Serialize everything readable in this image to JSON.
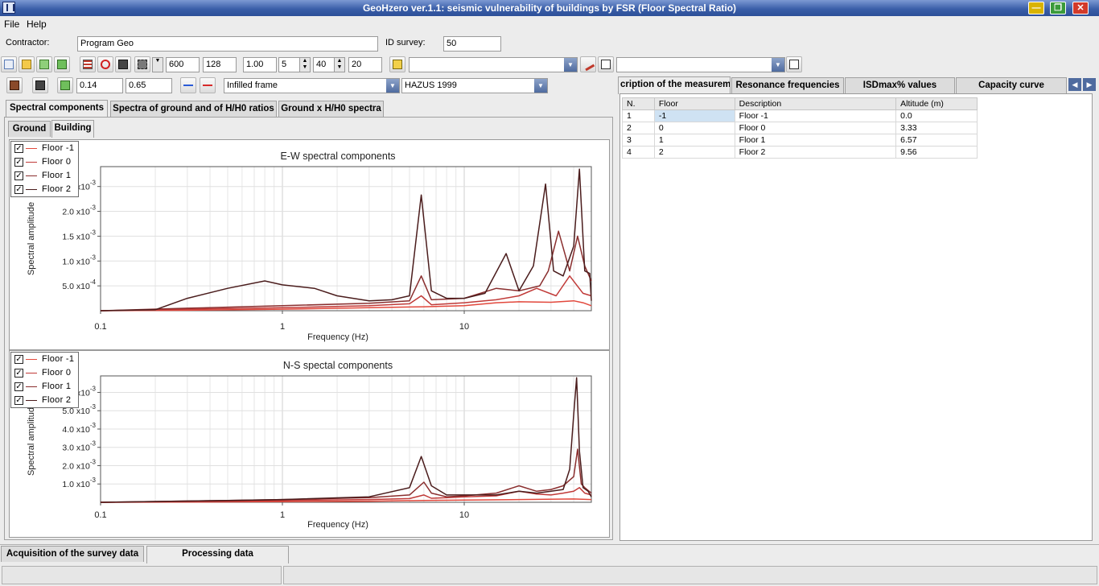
{
  "window": {
    "title": "GeoHzero ver.1.1: seismic vulnerability of buildings by FSR  (Floor Spectral Ratio)"
  },
  "menu": [
    "File",
    "Help"
  ],
  "form": {
    "contractor_label": "Contractor:",
    "contractor_value": "Program Geo",
    "survey_label": "ID survey:",
    "survey_value": "50"
  },
  "toolbar": {
    "values": [
      "600",
      "128",
      "1.00",
      "5",
      "40",
      "20"
    ],
    "selector1": "",
    "selector2": ""
  },
  "toolbar2": {
    "val1": "0.14",
    "val2": "0.65",
    "structure_type": "Infilled frame",
    "code": "HAZUS 1999"
  },
  "left_tabs": [
    "Spectral components",
    "Spectra of ground and of H/H0 ratios",
    "Ground x H/H0 spectra"
  ],
  "sub_tabs": [
    "Ground",
    "Building"
  ],
  "legend": [
    "Floor -1",
    "Floor 0",
    "Floor 1",
    "Floor 2"
  ],
  "colors": {
    "floor_m1": "#e2483c",
    "floor_0": "#c03a38",
    "floor_1": "#8a2e2e",
    "floor_2": "#4a1c1c"
  },
  "right_tabs": [
    "cription of the measurements",
    "Resonance frequencies",
    "ISDmax% values",
    "Capacity curve"
  ],
  "table": {
    "headers": [
      "N.",
      "Floor",
      "Description",
      "Altitude (m)"
    ],
    "rows": [
      [
        "1",
        "-1",
        "Floor -1",
        "0.0"
      ],
      [
        "2",
        "0",
        "Floor 0",
        "3.33"
      ],
      [
        "3",
        "1",
        "Floor 1",
        "6.57"
      ],
      [
        "4",
        "2",
        "Floor 2",
        "9.56"
      ]
    ]
  },
  "bottom_tabs": [
    "Acquisition of the survey data",
    "Processing data"
  ],
  "chart_data": [
    {
      "type": "line",
      "title": "E-W spectral components",
      "xlabel": "Frequency (Hz)",
      "ylabel": "Spectral amplitude",
      "xscale": "log",
      "xlim": [
        0.1,
        50
      ],
      "ylim": [
        0,
        0.0029
      ],
      "xticks": [
        "0.1",
        "1",
        "10"
      ],
      "yticks": [
        {
          "m": "5.0",
          "e": "-4",
          "v": 0.0005
        },
        {
          "m": "1.0",
          "e": "-3",
          "v": 0.001
        },
        {
          "m": "1.5",
          "e": "-3",
          "v": 0.0015
        },
        {
          "m": "2.0",
          "e": "-3",
          "v": 0.002
        },
        {
          "m": "",
          "e": "-3",
          "v": 0.0025
        }
      ],
      "legend_position": "top-left",
      "grid": true,
      "series": [
        {
          "name": "Floor -1",
          "x": [
            0.1,
            0.3,
            1,
            3,
            6,
            10,
            15,
            20,
            30,
            40,
            45,
            50
          ],
          "y": [
            0,
            1e-05,
            3e-05,
            6e-05,
            8e-05,
            0.0001,
            0.00016,
            0.00018,
            0.00017,
            0.0002,
            0.00016,
            0.0001
          ]
        },
        {
          "name": "Floor 0",
          "x": [
            0.1,
            0.3,
            1,
            3,
            5,
            5.8,
            6.6,
            10,
            15,
            20,
            25,
            32,
            38,
            45,
            50
          ],
          "y": [
            0,
            3e-05,
            6e-05,
            0.0001,
            0.00014,
            0.0003,
            0.00012,
            0.00016,
            0.00022,
            0.0003,
            0.00045,
            0.0003,
            0.0007,
            0.00035,
            0.0003
          ]
        },
        {
          "name": "Floor 1",
          "x": [
            0.1,
            0.3,
            1,
            3,
            5,
            5.8,
            6.6,
            10,
            15,
            20,
            26,
            29,
            33,
            38,
            42,
            46,
            50
          ],
          "y": [
            0,
            5e-05,
            0.0001,
            0.00015,
            0.0002,
            0.0007,
            0.00022,
            0.00025,
            0.00045,
            0.0004,
            0.0005,
            0.0008,
            0.0016,
            0.0008,
            0.0015,
            0.0009,
            0.0006
          ]
        },
        {
          "name": "Floor 2",
          "x": [
            0.1,
            0.2,
            0.3,
            0.5,
            0.8,
            1,
            1.5,
            2,
            3,
            4,
            5,
            5.8,
            6.6,
            8,
            10,
            13,
            17,
            20,
            24,
            28,
            31,
            35,
            40,
            43,
            46,
            49,
            50
          ],
          "y": [
            0,
            2e-05,
            0.00025,
            0.00045,
            0.0006,
            0.00052,
            0.00045,
            0.0003,
            0.0002,
            0.00022,
            0.0003,
            0.00233,
            0.0004,
            0.00025,
            0.00025,
            0.00035,
            0.00115,
            0.0004,
            0.0009,
            0.00255,
            0.0008,
            0.0007,
            0.0013,
            0.00285,
            0.0008,
            0.00075,
            0.0002
          ]
        }
      ]
    },
    {
      "type": "line",
      "title": "N-S spectal components",
      "xlabel": "Frequency (Hz)",
      "ylabel": "Spectral amplitude",
      "xscale": "log",
      "xlim": [
        0.1,
        50
      ],
      "ylim": [
        0,
        0.0069
      ],
      "xticks": [
        "0.1",
        "1",
        "10"
      ],
      "yticks": [
        {
          "m": "1.0",
          "e": "-3",
          "v": 0.001
        },
        {
          "m": "2.0",
          "e": "-3",
          "v": 0.002
        },
        {
          "m": "3.0",
          "e": "-3",
          "v": 0.003
        },
        {
          "m": "4.0",
          "e": "-3",
          "v": 0.004
        },
        {
          "m": "5.0",
          "e": "-3",
          "v": 0.005
        },
        {
          "m": "",
          "e": "-3",
          "v": 0.006
        }
      ],
      "legend_position": "top-left",
      "grid": true,
      "series": [
        {
          "name": "Floor -1",
          "x": [
            0.1,
            0.5,
            1,
            3,
            6,
            10,
            20,
            40,
            50
          ],
          "y": [
            0,
            2e-05,
            4e-05,
            6e-05,
            0.0001,
            0.00012,
            0.00015,
            0.00018,
            0.00015
          ]
        },
        {
          "name": "Floor 0",
          "x": [
            0.1,
            0.5,
            1,
            3,
            5,
            6,
            6.6,
            8,
            10,
            15,
            20,
            25,
            30,
            35,
            40,
            43,
            46,
            50
          ],
          "y": [
            0,
            5e-05,
            0.0001,
            0.00015,
            0.0002,
            0.0004,
            0.00022,
            0.00025,
            0.0003,
            0.00035,
            0.0006,
            0.00045,
            0.0004,
            0.0005,
            0.0006,
            0.0008,
            0.0005,
            0.0004
          ]
        },
        {
          "name": "Floor 1",
          "x": [
            0.1,
            0.5,
            1,
            3,
            5,
            6,
            6.6,
            8,
            10,
            15,
            20,
            25,
            30,
            35,
            40,
            42,
            44,
            46,
            50
          ],
          "y": [
            0,
            0.0001,
            0.00015,
            0.00025,
            0.0004,
            0.0011,
            0.0005,
            0.0003,
            0.00035,
            0.0005,
            0.0009,
            0.0006,
            0.0007,
            0.0009,
            0.0014,
            0.0029,
            0.001,
            0.0008,
            0.0005
          ]
        },
        {
          "name": "Floor 2",
          "x": [
            0.1,
            0.5,
            1,
            3,
            5,
            5.8,
            6.6,
            8,
            10,
            15,
            20,
            25,
            30,
            35,
            38,
            40,
            41.5,
            43,
            45,
            48,
            50
          ],
          "y": [
            0,
            0.0001,
            0.00015,
            0.0003,
            0.0008,
            0.0025,
            0.0009,
            0.0004,
            0.0004,
            0.0004,
            0.0006,
            0.0005,
            0.0006,
            0.0007,
            0.0018,
            0.0048,
            0.0068,
            0.0028,
            0.0008,
            0.0006,
            0.0003
          ]
        }
      ]
    }
  ]
}
